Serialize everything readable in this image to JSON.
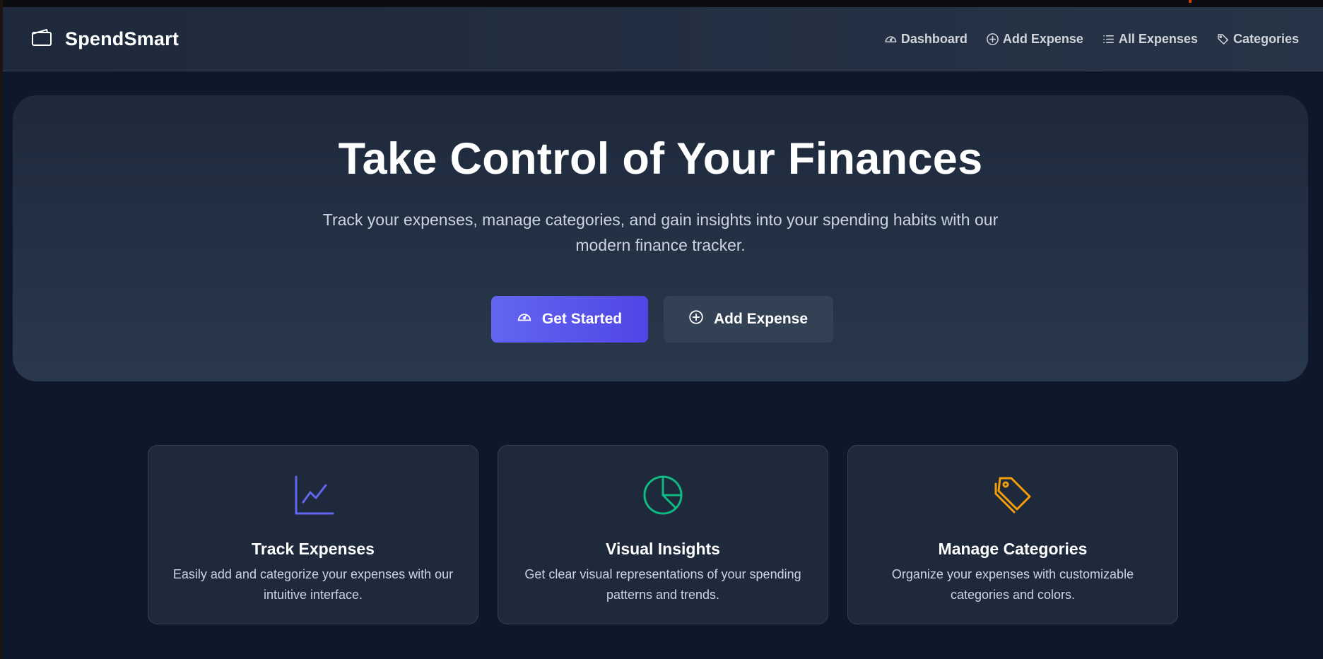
{
  "app": {
    "name": "SpendSmart"
  },
  "nav": {
    "items": [
      {
        "label": "Dashboard",
        "icon": "gauge-icon"
      },
      {
        "label": "Add Expense",
        "icon": "plus-circle-icon"
      },
      {
        "label": "All Expenses",
        "icon": "list-icon"
      },
      {
        "label": "Categories",
        "icon": "tags-icon"
      }
    ]
  },
  "hero": {
    "title": "Take Control of Your Finances",
    "subtitle": "Track your expenses, manage categories, and gain insights into your spending habits with our modern finance tracker.",
    "primary_button": "Get Started",
    "secondary_button": "Add Expense"
  },
  "features": [
    {
      "title": "Track Expenses",
      "description": "Easily add and categorize your expenses with our intuitive interface.",
      "icon": "line-chart-icon",
      "color": "#6366f1"
    },
    {
      "title": "Visual Insights",
      "description": "Get clear visual representations of your spending patterns and trends.",
      "icon": "pie-chart-icon",
      "color": "#10b981"
    },
    {
      "title": "Manage Categories",
      "description": "Organize your expenses with customizable categories and colors.",
      "icon": "tags-icon",
      "color": "#f59e0b"
    }
  ],
  "colors": {
    "background": "#0f172a",
    "surface": "#1e293b",
    "accent": "#6366f1"
  }
}
